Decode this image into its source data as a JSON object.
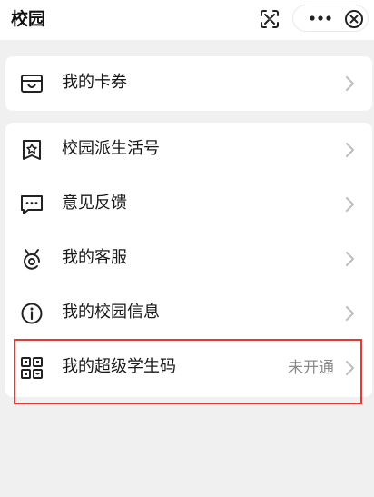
{
  "header": {
    "title": "校园"
  },
  "cards": {
    "first": {
      "coupons_label": "我的卡券"
    },
    "second": {
      "items": [
        {
          "label": "校园派生活号",
          "status": ""
        },
        {
          "label": "意见反馈",
          "status": ""
        },
        {
          "label": "我的客服",
          "status": ""
        },
        {
          "label": "我的校园信息",
          "status": ""
        },
        {
          "label": "我的超级学生码",
          "status": "未开通"
        }
      ]
    }
  },
  "colors": {
    "highlight_border": "#e53935",
    "status_text": "#8a8a8a",
    "page_bg": "#f0f0f0"
  },
  "icons": {
    "scan": "scan-icon",
    "more": "more-icon",
    "close": "close-icon",
    "coupon": "coupon-icon",
    "star_bookmark": "star-bookmark-icon",
    "feedback": "feedback-icon",
    "service": "customer-service-icon",
    "info": "info-icon",
    "qr": "qr-code-icon",
    "chevron": "chevron-right-icon"
  }
}
